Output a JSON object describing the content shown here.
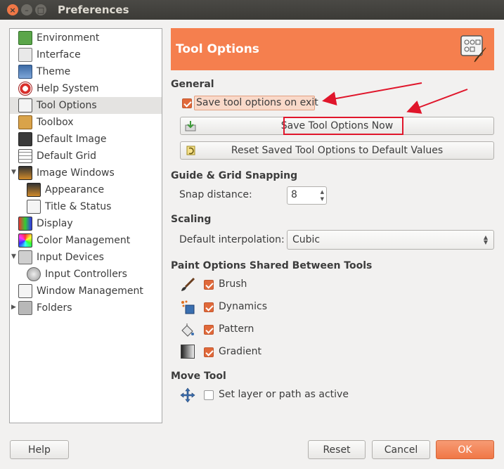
{
  "window": {
    "title": "Preferences"
  },
  "colors": {
    "accent": "#f57f4e",
    "highlight": "#e0162b"
  },
  "sidebar": {
    "items": [
      {
        "label": "Environment",
        "icon": "environment-icon"
      },
      {
        "label": "Interface",
        "icon": "interface-icon"
      },
      {
        "label": "Theme",
        "icon": "theme-icon"
      },
      {
        "label": "Help System",
        "icon": "help-system-icon"
      },
      {
        "label": "Tool Options",
        "icon": "tool-options-icon",
        "selected": true
      },
      {
        "label": "Toolbox",
        "icon": "toolbox-icon"
      },
      {
        "label": "Default Image",
        "icon": "default-image-icon"
      },
      {
        "label": "Default Grid",
        "icon": "default-grid-icon"
      },
      {
        "label": "Image Windows",
        "icon": "image-windows-icon",
        "expanded": true
      },
      {
        "label": "Appearance",
        "icon": "appearance-icon",
        "child": true
      },
      {
        "label": "Title & Status",
        "icon": "title-status-icon",
        "child": true
      },
      {
        "label": "Display",
        "icon": "display-icon"
      },
      {
        "label": "Color Management",
        "icon": "color-management-icon"
      },
      {
        "label": "Input Devices",
        "icon": "input-devices-icon",
        "expanded": true
      },
      {
        "label": "Input Controllers",
        "icon": "input-controllers-icon",
        "child": true
      },
      {
        "label": "Window Management",
        "icon": "window-management-icon"
      },
      {
        "label": "Folders",
        "icon": "folders-icon",
        "expanded": false
      }
    ]
  },
  "panel": {
    "title": "Tool Options",
    "general": {
      "heading": "General",
      "save_on_exit_label": "Save tool options on exit",
      "save_on_exit_checked": true,
      "save_now_label": "Save Tool Options Now",
      "reset_label": "Reset Saved Tool Options to Default Values"
    },
    "snapping": {
      "heading": "Guide & Grid Snapping",
      "snap_label": "Snap distance:",
      "snap_value": "8"
    },
    "scaling": {
      "heading": "Scaling",
      "interp_label": "Default interpolation:",
      "interp_value": "Cubic"
    },
    "paint": {
      "heading": "Paint Options Shared Between Tools",
      "brush": {
        "label": "Brush",
        "checked": true
      },
      "dynamics": {
        "label": "Dynamics",
        "checked": true
      },
      "pattern": {
        "label": "Pattern",
        "checked": true
      },
      "gradient": {
        "label": "Gradient",
        "checked": true
      }
    },
    "move": {
      "heading": "Move Tool",
      "active_label": "Set layer or path as active",
      "active_checked": false
    }
  },
  "footer": {
    "help_label": "Help",
    "reset_label": "Reset",
    "cancel_label": "Cancel",
    "ok_label": "OK"
  }
}
